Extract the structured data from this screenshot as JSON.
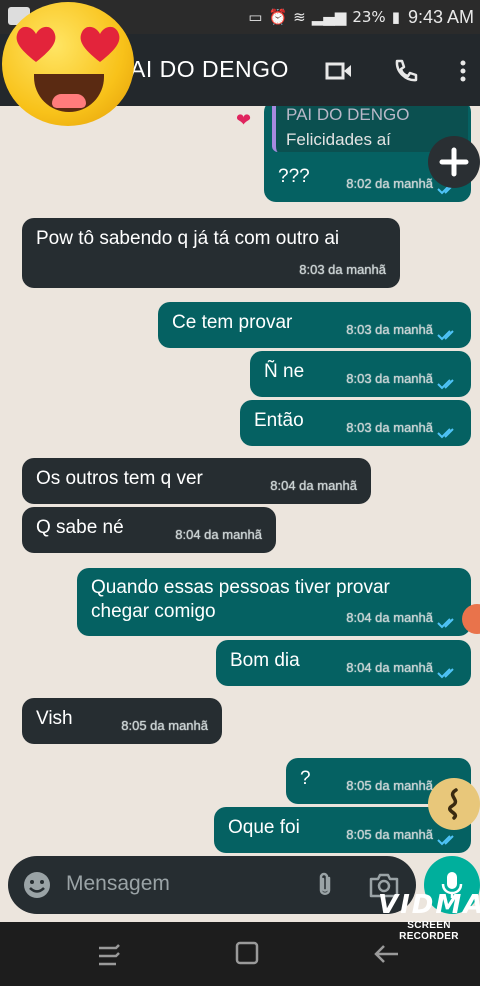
{
  "status": {
    "battery": "23%",
    "time": "9:43 AM"
  },
  "header": {
    "title": "AI DO DENGO"
  },
  "reply_preview": {
    "name": "PAI DO DENGO",
    "text": "Felicidades aí"
  },
  "messages": [
    {
      "dir": "out",
      "text": "???",
      "time": "8:02 da manhã"
    },
    {
      "dir": "in",
      "text": "Pow tô sabendo q já tá com outro ai",
      "time": "8:03 da manhã"
    },
    {
      "dir": "out",
      "text": "Ce tem provar",
      "time": "8:03 da manhã"
    },
    {
      "dir": "out",
      "text": "Ñ ne",
      "time": "8:03 da manhã"
    },
    {
      "dir": "out",
      "text": "Então",
      "time": "8:03 da manhã"
    },
    {
      "dir": "in",
      "text": "Os outros tem q ver",
      "time": "8:04 da manhã"
    },
    {
      "dir": "in",
      "text": "Q sabe né",
      "time": "8:04 da manhã"
    },
    {
      "dir": "out",
      "text": "Quando essas pessoas tiver provar chegar comigo",
      "time": "8:04 da manhã"
    },
    {
      "dir": "out",
      "text": "Bom dia",
      "time": "8:04 da manhã"
    },
    {
      "dir": "in",
      "text": "Vish",
      "time": "8:05 da manhã"
    },
    {
      "dir": "out",
      "text": "?",
      "time": "8:05 da manhã"
    },
    {
      "dir": "out",
      "text": "Oque foi",
      "time": "8:05 da manhã"
    }
  ],
  "composer": {
    "placeholder": "Mensagem"
  },
  "watermark": {
    "brand": "VIDMA",
    "sub": "SCREEN RECORDER"
  },
  "colors": {
    "outgoing": "#056162",
    "incoming": "#262d31",
    "mic": "#00af9c"
  }
}
